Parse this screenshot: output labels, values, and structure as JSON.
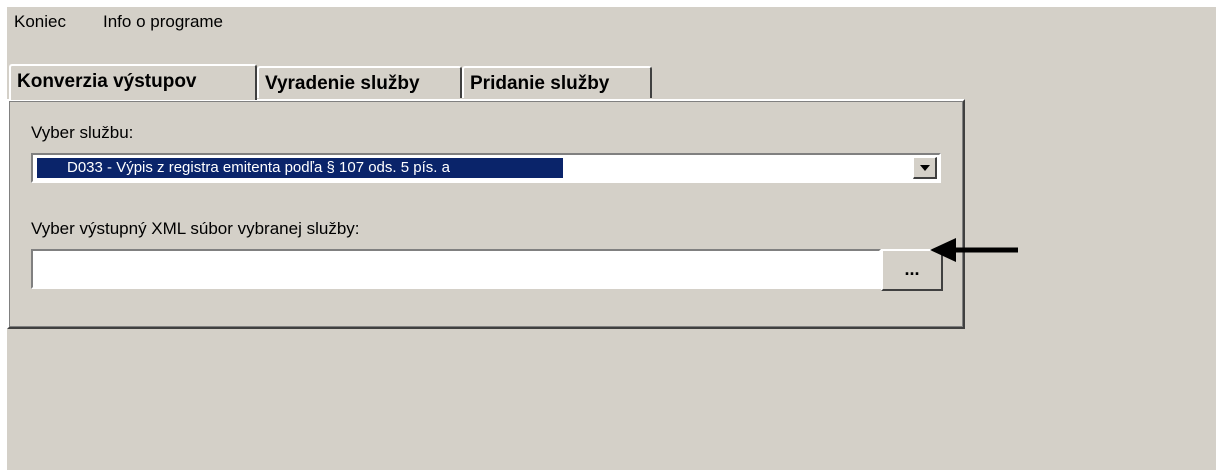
{
  "menu": {
    "items": [
      "Koniec",
      "Info o programe"
    ]
  },
  "tabs": [
    {
      "label": "Konverzia výstupov",
      "active": true
    },
    {
      "label": "Vyradenie služby",
      "active": false
    },
    {
      "label": "Pridanie služby",
      "active": false
    }
  ],
  "form": {
    "service_label": "Vyber službu:",
    "service_selected": "D033 - Výpis z registra emitenta podľa § 107 ods. 5 pís. a",
    "file_label": "Vyber výstupný XML súbor vybranej služby:",
    "file_value": "",
    "browse_label": "..."
  },
  "annotation": {
    "arrow_icon": "arrow-left-icon"
  }
}
